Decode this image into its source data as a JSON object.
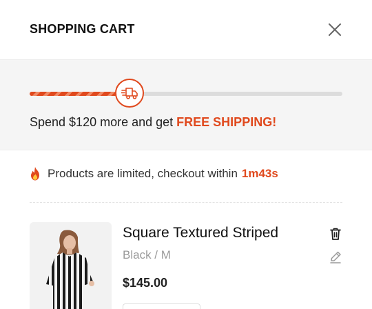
{
  "header": {
    "title": "SHOPPING CART",
    "close_icon": "close-icon"
  },
  "shipping": {
    "progress_fraction": 0.32,
    "prefix": "Spend $120 more and get ",
    "highlight": "FREE SHIPPING!",
    "icon": "truck-icon"
  },
  "notice": {
    "icon": "fire-icon",
    "text": "Products are limited, checkout within",
    "time": "1m43s"
  },
  "cart": {
    "items": [
      {
        "name": "Square Textured Striped",
        "variant": "Black / M",
        "price": "$145.00",
        "delete_icon": "trash-icon",
        "edit_icon": "pencil-icon"
      }
    ]
  },
  "colors": {
    "accent": "#e0491d",
    "panel_bg": "#f5f5f5"
  }
}
